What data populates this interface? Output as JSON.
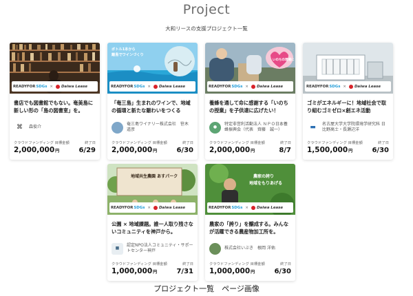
{
  "header": {
    "title": "Project",
    "subtitle": "大和リースの支援プロジェクト一覧"
  },
  "brand": {
    "readyfor": "READYFOR",
    "sdgs": "SDGs",
    "x": "×",
    "daiwa": "Daiwa Lease"
  },
  "labels": {
    "goal": "クラウドファンディング 目標金額",
    "end": "終了日",
    "yen": "円"
  },
  "image_texts": {
    "card2_line1": "ボトル1本から",
    "card2_line2": "離島でワインづくり",
    "card3_heart": "いのちの現場に",
    "card5_sign": "地域共生農園 あすパーク",
    "card6_line1": "農家の誇り",
    "card6_line2": "地域をもりあげる"
  },
  "cards": [
    {
      "title": "書店でも図書館でもない。奄美島に新しい形の「島の図書室」を。",
      "org": "森俊介",
      "amount": "2,000,000",
      "date": "6/29"
    },
    {
      "title": "「奄三島」生まれのワインで、地域の循環と新たな賑わいをつくる",
      "org": "奄三島ワイナリー株式会社　笹木 道彦",
      "amount": "2,000,000",
      "date": "6/30"
    },
    {
      "title": "養蜂を通して命に感謝する「いのちの授業」を子供達に広げたい！",
      "org": "特定非営利活動法人 ＮＰＯ日本養蜂振興会（代表　齊藤　誠一）",
      "amount": "2,000,000",
      "date": "8/7"
    },
    {
      "title": "ゴミがエネルギーに！地域社会で取り組むゴミゼロ×創エネ活動",
      "org": "名古屋大学大学院環境学研究科 日比野高士・長瀬辺洋",
      "amount": "1,500,000",
      "date": "6/30"
    },
    {
      "title": "公園 × 地域課題。誰一人取り残さないコミュニティを神戸から。",
      "org": "認定NPO法人コミュニティ・サポートセンター神戸",
      "amount": "1,000,000",
      "date": "7/31"
    },
    {
      "title": "農家の「誇り」を醸成する。みんなが活躍できる農産物加工所を。",
      "org": "株式会社いぶき　根岡 洋佑",
      "amount": "1,000,000",
      "date": "6/30"
    }
  ],
  "footer": {
    "caption": "プロジェクト一覧　ページ画像"
  }
}
